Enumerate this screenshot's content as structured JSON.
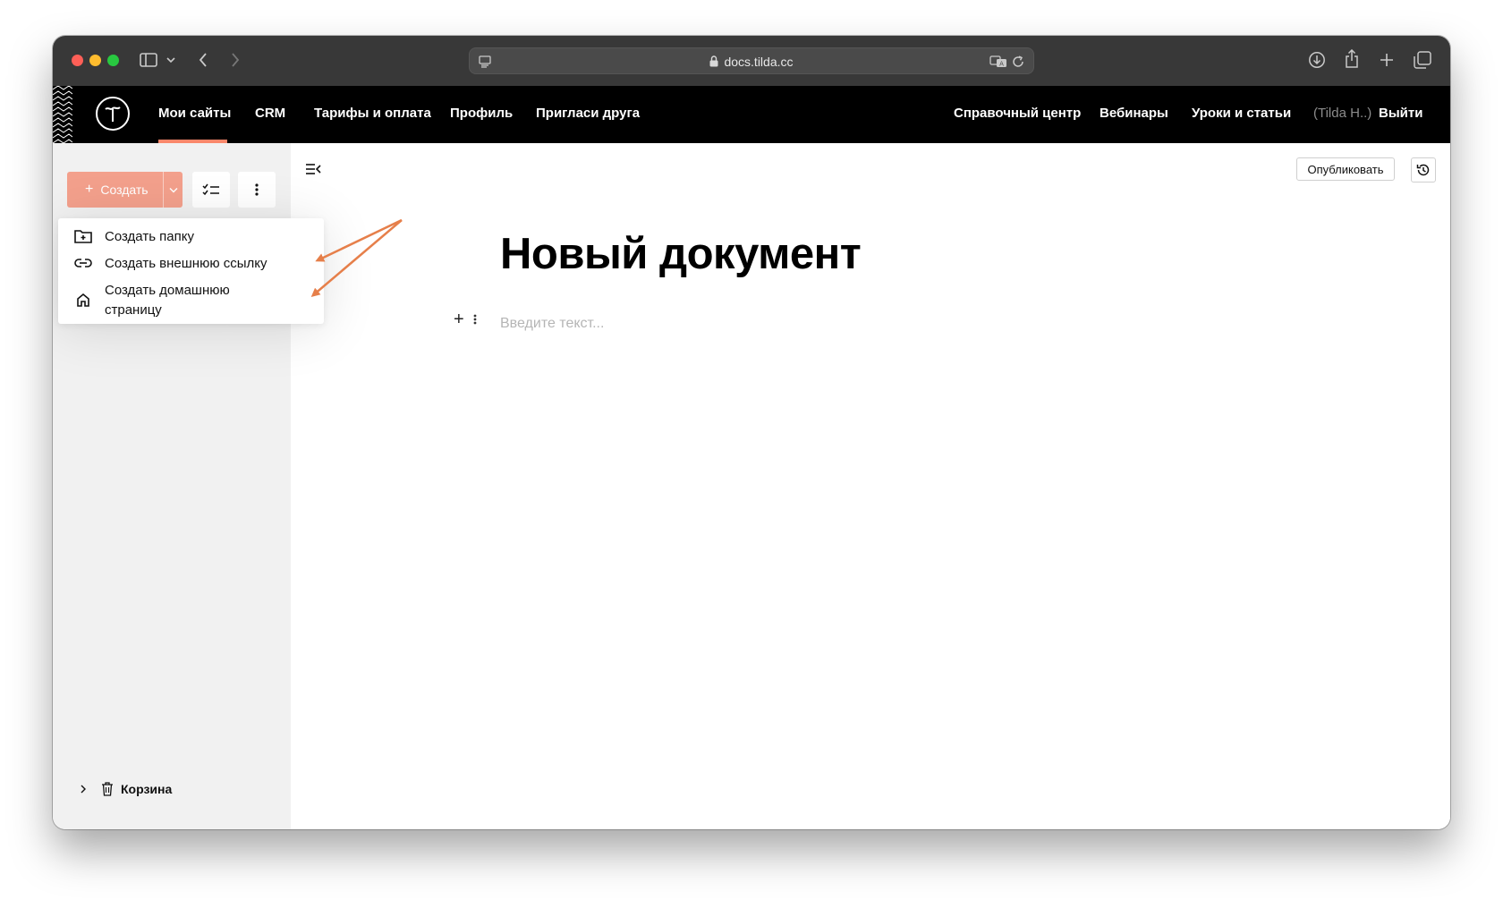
{
  "browser": {
    "url": "docs.tilda.cc"
  },
  "topnav": {
    "left_items": [
      "Мои сайты",
      "CRM",
      "Тарифы и оплата",
      "Профиль",
      "Пригласи друга"
    ],
    "right_items": [
      "Справочный центр",
      "Вебинары",
      "Уроки и статьи"
    ],
    "user_label": "(Tilda H..)",
    "logout_label": "Выйти"
  },
  "sidebar": {
    "create_label": "Создать",
    "trash_label": "Корзина"
  },
  "menu": {
    "items": [
      "Создать папку",
      "Создать внешнюю ссылку",
      "Создать домашнюю страницу"
    ]
  },
  "editor": {
    "publish_label": "Опубликовать",
    "title": "Новый документ",
    "placeholder": "Введите текст..."
  },
  "colors": {
    "accent": "#fa876b",
    "create_button": "#f3a08c",
    "annotation_arrow": "#e67f4a"
  },
  "icons": [
    "sidebar-toggle-icon",
    "chevron-down-icon",
    "back-icon",
    "forward-icon",
    "reader-icon",
    "lock-icon",
    "translate-icon",
    "reload-icon",
    "download-icon",
    "share-icon",
    "new-tab-icon",
    "tabs-overview-icon",
    "tilda-logo-icon",
    "checklist-icon",
    "more-vertical-icon",
    "collapse-sidebar-icon",
    "history-icon",
    "folder-plus-icon",
    "link-icon",
    "home-icon",
    "trash-icon",
    "chevron-right-icon"
  ]
}
